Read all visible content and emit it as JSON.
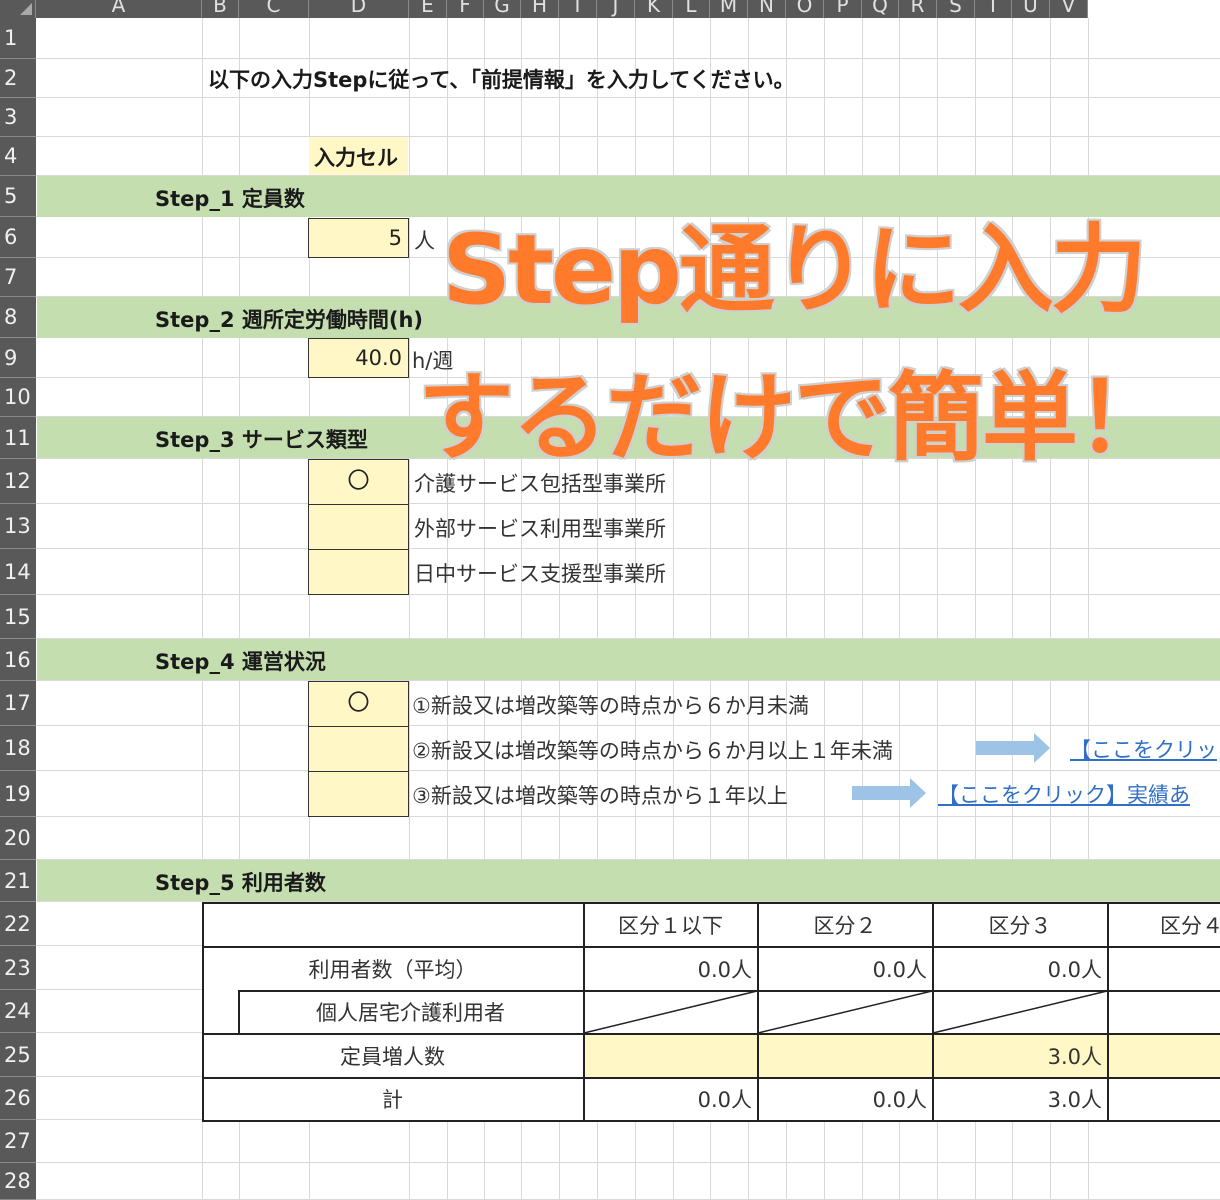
{
  "columns": [
    "A",
    "B",
    "C",
    "D",
    "E",
    "F",
    "G",
    "H",
    "I",
    "J",
    "K",
    "L",
    "M",
    "N",
    "O",
    "P",
    "Q",
    "R",
    "S",
    "T",
    "U",
    "V"
  ],
  "rows": [
    "1",
    "2",
    "3",
    "4",
    "5",
    "6",
    "7",
    "8",
    "9",
    "10",
    "11",
    "12",
    "13",
    "14",
    "15",
    "16",
    "17",
    "18",
    "19",
    "20",
    "21",
    "22",
    "23",
    "24",
    "25",
    "26",
    "27",
    "28"
  ],
  "instruction": "以下の入力Stepに従って、「前提情報」を入力してください。",
  "legend_label": "入力セル",
  "step1": {
    "title": "Step_1  定員数",
    "value": "5",
    "unit": "人"
  },
  "step2": {
    "title": "Step_2  週所定労働時間(h)",
    "value": "40.0",
    "unit": "h/週"
  },
  "step3": {
    "title": "Step_3  サービス類型",
    "options": [
      {
        "mark": "〇",
        "label": "介護サービス包括型事業所"
      },
      {
        "mark": "",
        "label": "外部サービス利用型事業所"
      },
      {
        "mark": "",
        "label": "日中サービス支援型事業所"
      }
    ]
  },
  "step4": {
    "title": "Step_4  運営状況",
    "options": [
      {
        "mark": "〇",
        "label": "①新設又は増改築等の時点から６か月未満"
      },
      {
        "mark": "",
        "label": "②新設又は増改築等の時点から６か月以上１年未満",
        "link": "【ここをクリッ"
      },
      {
        "mark": "",
        "label": "③新設又は増改築等の時点から１年以上",
        "link": "【ここをクリック】実績あ"
      }
    ]
  },
  "step5": {
    "title": "Step_5  利用者数",
    "headers": [
      "区分１以下",
      "区分２",
      "区分３",
      "区分４"
    ],
    "rows": [
      {
        "label": "利用者数（平均）",
        "values": [
          "0.0人",
          "0.0人",
          "0.0人"
        ]
      },
      {
        "label": "個人居宅介護利用者",
        "values": [
          "",
          "",
          ""
        ]
      },
      {
        "label": "定員増人数",
        "values": [
          "",
          "",
          "3.0人"
        ]
      },
      {
        "label": "計",
        "values": [
          "0.0人",
          "0.0人",
          "3.0人"
        ]
      }
    ]
  },
  "overlay": {
    "line1": "Step通りに入力",
    "line2": "するだけで簡単！"
  },
  "colors": {
    "band": "#c5deb0",
    "input_cell": "#fff8c6",
    "overlay_text": "#ff7a2b",
    "link": "#2f6fc8",
    "arrow": "#9dc3e6"
  }
}
